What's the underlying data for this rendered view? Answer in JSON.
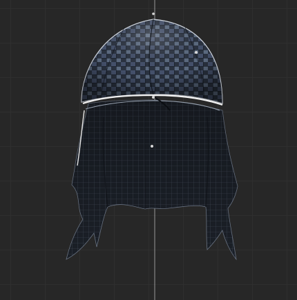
{
  "viewport": {
    "background_color": "#272727",
    "grid_color": "#2f2f2f",
    "axis_line_color": "#9a9a9a",
    "object": "cap-with-cloth-drape-wireframe",
    "icons": [
      "vertex-marker-icon"
    ]
  }
}
